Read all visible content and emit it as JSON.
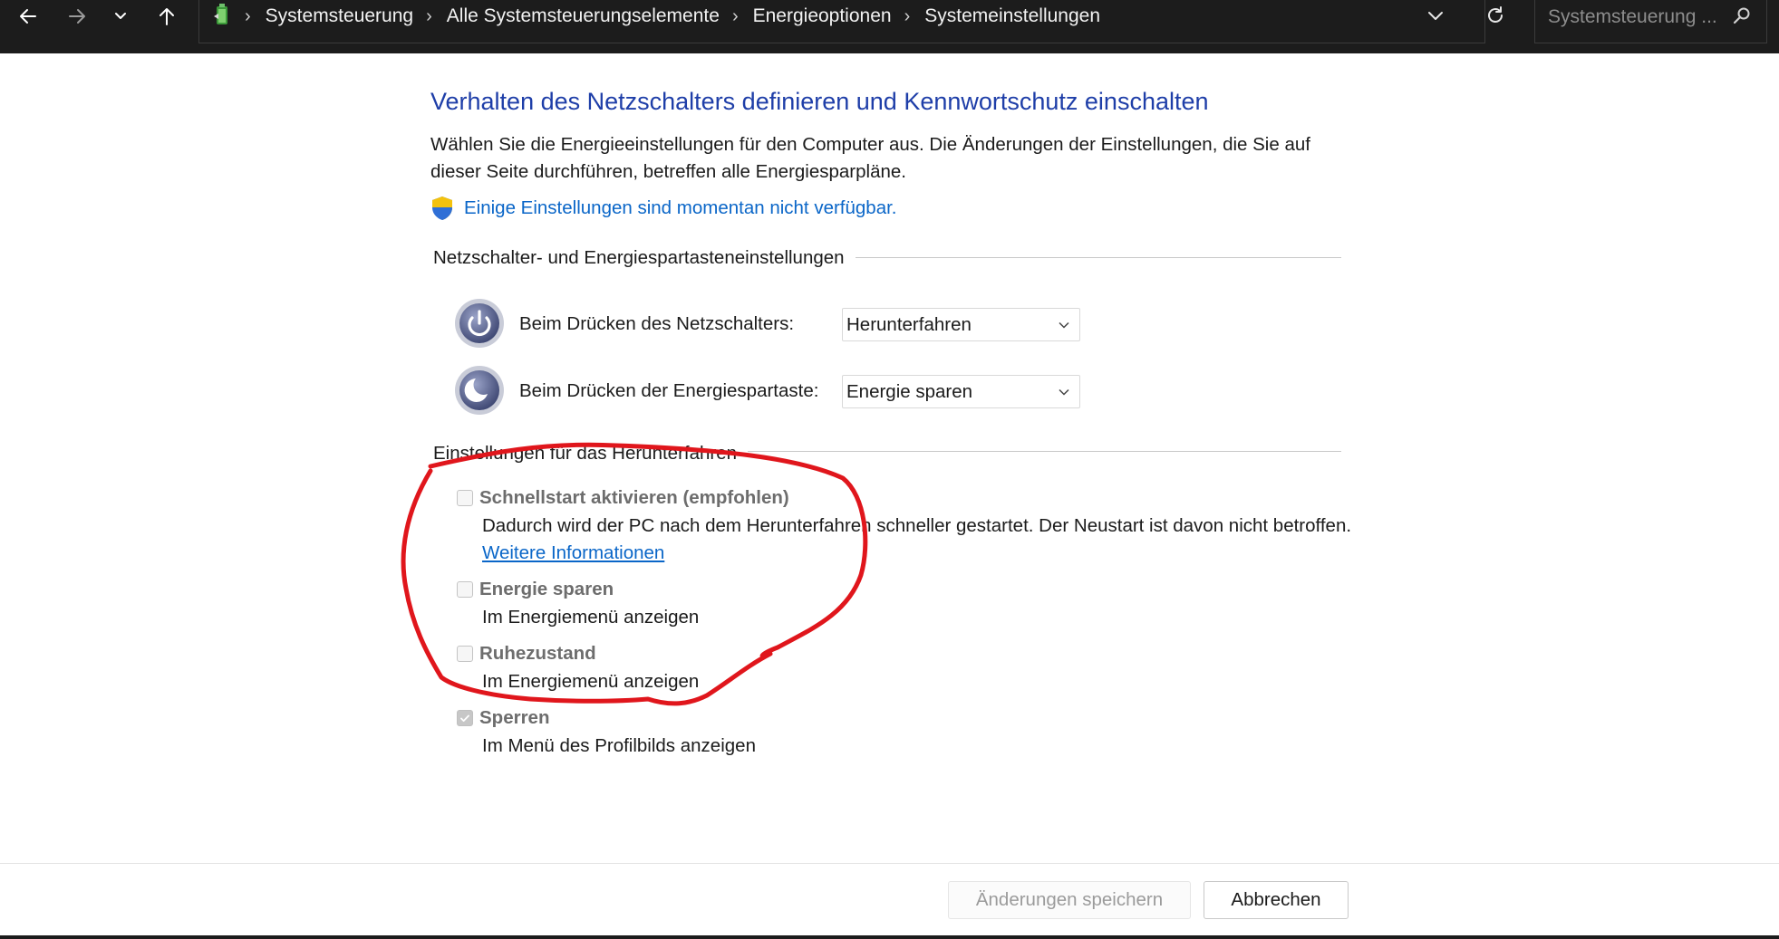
{
  "nav": {
    "breadcrumbs": [
      "Systemsteuerung",
      "Alle Systemsteuerungselemente",
      "Energieoptionen",
      "Systemeinstellungen"
    ],
    "search_placeholder": "Systemsteuerung ..."
  },
  "page": {
    "title": "Verhalten des Netzschalters definieren und Kennwortschutz einschalten",
    "description": "Wählen Sie die Energieeinstellungen für den Computer aus. Die Änderungen der Einstellungen, die Sie auf dieser Seite durchführen, betreffen alle Energiesparpläne.",
    "unavailable_link": "Einige Einstellungen sind momentan nicht verfügbar."
  },
  "power_buttons": {
    "group_label": "Netzschalter- und Energiespartasteneinstellungen",
    "power_label": "Beim Drücken des Netzschalters:",
    "power_value": "Herunterfahren",
    "sleep_label": "Beim Drücken der Energiespartaste:",
    "sleep_value": "Energie sparen"
  },
  "shutdown": {
    "group_label": "Einstellungen für das Herunterfahren",
    "options": [
      {
        "title": "Schnellstart aktivieren (empfohlen)",
        "description": "Dadurch wird der PC nach dem Herunterfahren schneller gestartet. Der Neustart ist davon nicht betroffen.",
        "link": "Weitere Informationen",
        "checked": false
      },
      {
        "title": "Energie sparen",
        "description": "Im Energiemenü anzeigen",
        "checked": false
      },
      {
        "title": "Ruhezustand",
        "description": "Im Energiemenü anzeigen",
        "checked": false
      },
      {
        "title": "Sperren",
        "description": "Im Menü des Profilbilds anzeigen",
        "checked": true
      }
    ]
  },
  "footer": {
    "save_label": "Änderungen speichern",
    "cancel_label": "Abbrechen"
  },
  "colors": {
    "title": "#1e3ea8",
    "link": "#0a66c8",
    "annotation": "#e0161c",
    "topbar": "#1c1c1c"
  },
  "icons": [
    "back-arrow-icon",
    "forward-arrow-icon",
    "chevron-down-icon",
    "up-arrow-icon",
    "control-panel-icon",
    "refresh-icon",
    "search-icon",
    "shield-icon",
    "power-icon",
    "sleep-icon",
    "checkmark-icon"
  ]
}
